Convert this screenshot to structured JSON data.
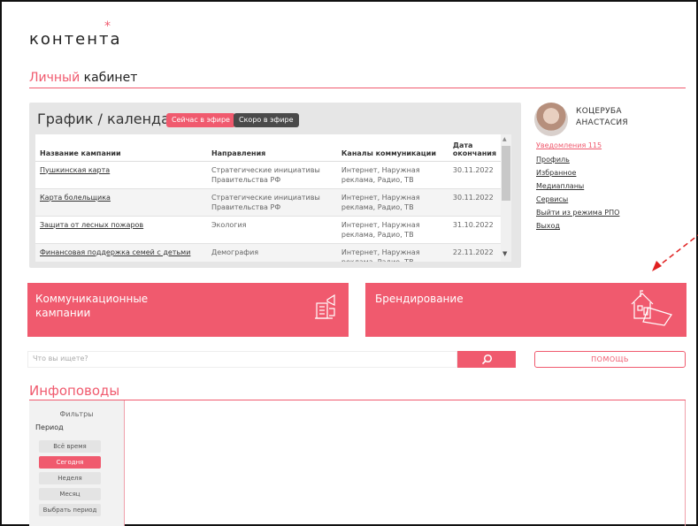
{
  "brand": {
    "logo_text": "контента",
    "logo_mark": "*"
  },
  "page": {
    "title_accent": "Личный",
    "title_rest": "кабинет"
  },
  "calendar": {
    "title": "График / календарь",
    "badge_live": "Сейчас в эфире",
    "badge_soon": "Скоро в эфире",
    "columns": [
      "Название кампании",
      "Направления",
      "Каналы коммуникации",
      "Дата окончания"
    ],
    "rows": [
      {
        "name": "Пушкинская карта",
        "direction": "Стратегические инициативы Правительства РФ",
        "channels": "Интернет, Наружная реклама, Радио, ТВ",
        "date": "30.11.2022"
      },
      {
        "name": "Карта болельщика",
        "direction": "Стратегические инициативы Правительства РФ",
        "channels": "Интернет, Наружная реклама, Радио, ТВ",
        "date": "30.11.2022"
      },
      {
        "name": "Защита от лесных пожаров",
        "direction": "Экология",
        "channels": "Интернет, Наружная реклама, Радио, ТВ",
        "date": "31.10.2022"
      },
      {
        "name": "Финансовая поддержка семей с детьми",
        "direction": "Демография",
        "channels": "Интернет, Наружная реклама, Радио, ТВ",
        "date": "22.11.2022"
      }
    ]
  },
  "user": {
    "name_line1": "КОЦЕРУБА",
    "name_line2": "АНАСТАСИЯ",
    "links": {
      "notifications": "Уведомления 115",
      "profile": "Профиль",
      "favorites": "Избранное",
      "mediaplans": "Медиапланы",
      "services": "Сервисы",
      "exit_rpo": "Выйти из режима РПО",
      "logout": "Выход"
    }
  },
  "tiles": {
    "communication_line1": "Коммуникационные",
    "communication_line2": "кампании",
    "branding": "Брендирование"
  },
  "search": {
    "placeholder": "Что вы ищете?",
    "help_label": "ПОМОЩЬ"
  },
  "infopovody": {
    "title": "Инфоповоды",
    "filters_title": "Фильтры",
    "period_label": "Период",
    "period_options": [
      "Всё время",
      "Сегодня",
      "Неделя",
      "Месяц",
      "Выбрать период"
    ],
    "active_option": "Сегодня"
  },
  "colors": {
    "accent": "#f05a6e",
    "panel_gray": "#e6e6e6",
    "dark_badge": "#4a4a4a"
  },
  "icons": [
    "asterisk-logo-icon",
    "search-icon",
    "megaphone-building-icon",
    "house-branding-icon",
    "scroll-up-icon",
    "scroll-down-icon"
  ]
}
